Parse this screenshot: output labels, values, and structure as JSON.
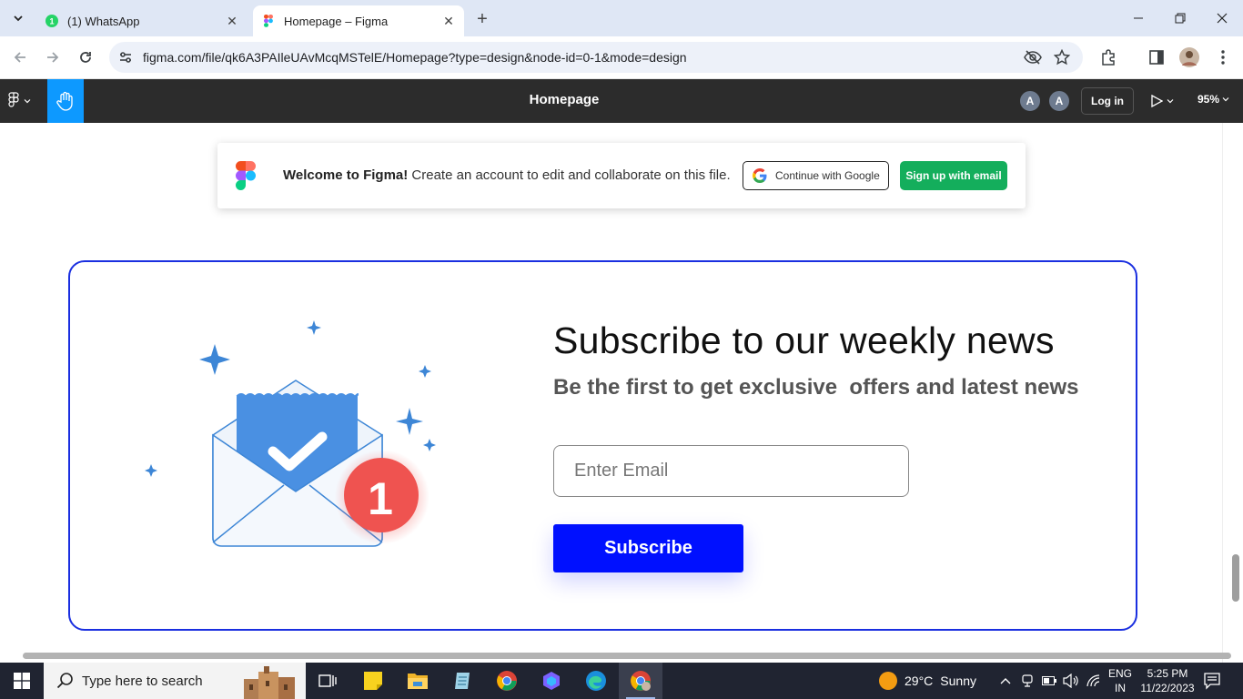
{
  "browser": {
    "tabs": [
      {
        "title": "(1) WhatsApp",
        "active": false
      },
      {
        "title": "Homepage – Figma",
        "active": true
      }
    ],
    "url": "figma.com/file/qk6A3PAIleUAvMcqMSTelE/Homepage?type=design&node-id=0-1&mode=design"
  },
  "figma": {
    "file_title": "Homepage",
    "avatars": [
      "A",
      "A"
    ],
    "login_label": "Log in",
    "zoom": "95%"
  },
  "banner": {
    "welcome_bold": "Welcome to Figma!",
    "welcome_text": " Create an account to edit and collaborate on this file.",
    "google_label": "Continue with Google",
    "signup_label": "Sign up with email"
  },
  "card": {
    "title": "Subscribe to our weekly news",
    "subtitle": "Be the first to get exclusive  offers and latest news",
    "email_placeholder": "Enter Email",
    "subscribe_label": "Subscribe",
    "notification_count": "1"
  },
  "taskbar": {
    "search_placeholder": "Type here to search",
    "weather_temp": "29°C",
    "weather_desc": "Sunny",
    "lang_line1": "ENG",
    "lang_line2": "IN",
    "time": "5:25 PM",
    "date": "11/22/2023"
  },
  "colors": {
    "figma_blue": "#0d99ff",
    "signup_green": "#14ae5c",
    "subscribe_blue": "#0010ff",
    "card_border": "#1a2fe0",
    "badge_red": "#ef5350"
  }
}
